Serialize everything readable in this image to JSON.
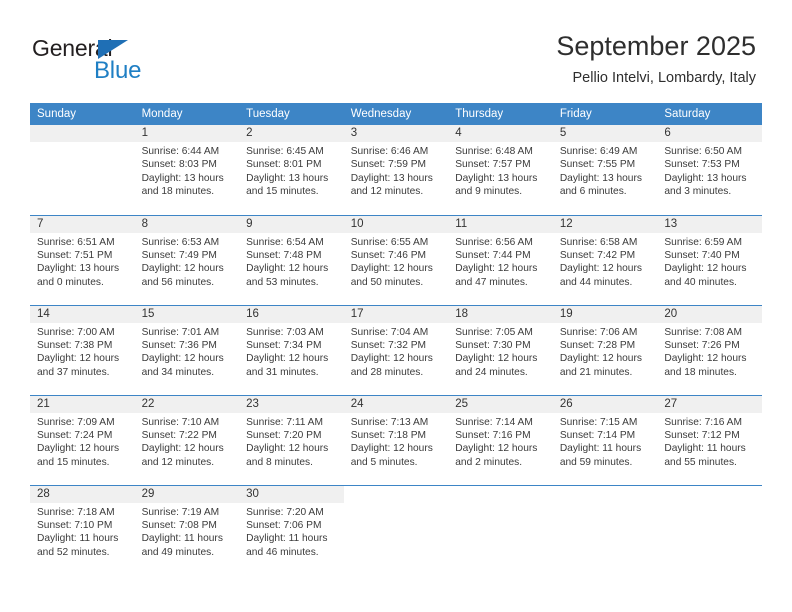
{
  "logo": {
    "word_one": "General",
    "word_two": "Blue",
    "triangle_color": "#1f6fb5",
    "blue_color": "#1f7fc4"
  },
  "header": {
    "title": "September 2025",
    "subtitle": "Pellio Intelvi, Lombardy, Italy",
    "header_bg": "#3d85c6",
    "daynum_bg": "#f0f0f0"
  },
  "calendar": {
    "weekday_headers": [
      "Sunday",
      "Monday",
      "Tuesday",
      "Wednesday",
      "Thursday",
      "Friday",
      "Saturday"
    ],
    "weeks": [
      [
        {
          "day": "",
          "blank": true
        },
        {
          "day": "1",
          "sunrise": "Sunrise: 6:44 AM",
          "sunset": "Sunset: 8:03 PM",
          "daylight_a": "Daylight: 13 hours",
          "daylight_b": "and 18 minutes."
        },
        {
          "day": "2",
          "sunrise": "Sunrise: 6:45 AM",
          "sunset": "Sunset: 8:01 PM",
          "daylight_a": "Daylight: 13 hours",
          "daylight_b": "and 15 minutes."
        },
        {
          "day": "3",
          "sunrise": "Sunrise: 6:46 AM",
          "sunset": "Sunset: 7:59 PM",
          "daylight_a": "Daylight: 13 hours",
          "daylight_b": "and 12 minutes."
        },
        {
          "day": "4",
          "sunrise": "Sunrise: 6:48 AM",
          "sunset": "Sunset: 7:57 PM",
          "daylight_a": "Daylight: 13 hours",
          "daylight_b": "and 9 minutes."
        },
        {
          "day": "5",
          "sunrise": "Sunrise: 6:49 AM",
          "sunset": "Sunset: 7:55 PM",
          "daylight_a": "Daylight: 13 hours",
          "daylight_b": "and 6 minutes."
        },
        {
          "day": "6",
          "sunrise": "Sunrise: 6:50 AM",
          "sunset": "Sunset: 7:53 PM",
          "daylight_a": "Daylight: 13 hours",
          "daylight_b": "and 3 minutes."
        }
      ],
      [
        {
          "day": "7",
          "sunrise": "Sunrise: 6:51 AM",
          "sunset": "Sunset: 7:51 PM",
          "daylight_a": "Daylight: 13 hours",
          "daylight_b": "and 0 minutes."
        },
        {
          "day": "8",
          "sunrise": "Sunrise: 6:53 AM",
          "sunset": "Sunset: 7:49 PM",
          "daylight_a": "Daylight: 12 hours",
          "daylight_b": "and 56 minutes."
        },
        {
          "day": "9",
          "sunrise": "Sunrise: 6:54 AM",
          "sunset": "Sunset: 7:48 PM",
          "daylight_a": "Daylight: 12 hours",
          "daylight_b": "and 53 minutes."
        },
        {
          "day": "10",
          "sunrise": "Sunrise: 6:55 AM",
          "sunset": "Sunset: 7:46 PM",
          "daylight_a": "Daylight: 12 hours",
          "daylight_b": "and 50 minutes."
        },
        {
          "day": "11",
          "sunrise": "Sunrise: 6:56 AM",
          "sunset": "Sunset: 7:44 PM",
          "daylight_a": "Daylight: 12 hours",
          "daylight_b": "and 47 minutes."
        },
        {
          "day": "12",
          "sunrise": "Sunrise: 6:58 AM",
          "sunset": "Sunset: 7:42 PM",
          "daylight_a": "Daylight: 12 hours",
          "daylight_b": "and 44 minutes."
        },
        {
          "day": "13",
          "sunrise": "Sunrise: 6:59 AM",
          "sunset": "Sunset: 7:40 PM",
          "daylight_a": "Daylight: 12 hours",
          "daylight_b": "and 40 minutes."
        }
      ],
      [
        {
          "day": "14",
          "sunrise": "Sunrise: 7:00 AM",
          "sunset": "Sunset: 7:38 PM",
          "daylight_a": "Daylight: 12 hours",
          "daylight_b": "and 37 minutes."
        },
        {
          "day": "15",
          "sunrise": "Sunrise: 7:01 AM",
          "sunset": "Sunset: 7:36 PM",
          "daylight_a": "Daylight: 12 hours",
          "daylight_b": "and 34 minutes."
        },
        {
          "day": "16",
          "sunrise": "Sunrise: 7:03 AM",
          "sunset": "Sunset: 7:34 PM",
          "daylight_a": "Daylight: 12 hours",
          "daylight_b": "and 31 minutes."
        },
        {
          "day": "17",
          "sunrise": "Sunrise: 7:04 AM",
          "sunset": "Sunset: 7:32 PM",
          "daylight_a": "Daylight: 12 hours",
          "daylight_b": "and 28 minutes."
        },
        {
          "day": "18",
          "sunrise": "Sunrise: 7:05 AM",
          "sunset": "Sunset: 7:30 PM",
          "daylight_a": "Daylight: 12 hours",
          "daylight_b": "and 24 minutes."
        },
        {
          "day": "19",
          "sunrise": "Sunrise: 7:06 AM",
          "sunset": "Sunset: 7:28 PM",
          "daylight_a": "Daylight: 12 hours",
          "daylight_b": "and 21 minutes."
        },
        {
          "day": "20",
          "sunrise": "Sunrise: 7:08 AM",
          "sunset": "Sunset: 7:26 PM",
          "daylight_a": "Daylight: 12 hours",
          "daylight_b": "and 18 minutes."
        }
      ],
      [
        {
          "day": "21",
          "sunrise": "Sunrise: 7:09 AM",
          "sunset": "Sunset: 7:24 PM",
          "daylight_a": "Daylight: 12 hours",
          "daylight_b": "and 15 minutes."
        },
        {
          "day": "22",
          "sunrise": "Sunrise: 7:10 AM",
          "sunset": "Sunset: 7:22 PM",
          "daylight_a": "Daylight: 12 hours",
          "daylight_b": "and 12 minutes."
        },
        {
          "day": "23",
          "sunrise": "Sunrise: 7:11 AM",
          "sunset": "Sunset: 7:20 PM",
          "daylight_a": "Daylight: 12 hours",
          "daylight_b": "and 8 minutes."
        },
        {
          "day": "24",
          "sunrise": "Sunrise: 7:13 AM",
          "sunset": "Sunset: 7:18 PM",
          "daylight_a": "Daylight: 12 hours",
          "daylight_b": "and 5 minutes."
        },
        {
          "day": "25",
          "sunrise": "Sunrise: 7:14 AM",
          "sunset": "Sunset: 7:16 PM",
          "daylight_a": "Daylight: 12 hours",
          "daylight_b": "and 2 minutes."
        },
        {
          "day": "26",
          "sunrise": "Sunrise: 7:15 AM",
          "sunset": "Sunset: 7:14 PM",
          "daylight_a": "Daylight: 11 hours",
          "daylight_b": "and 59 minutes."
        },
        {
          "day": "27",
          "sunrise": "Sunrise: 7:16 AM",
          "sunset": "Sunset: 7:12 PM",
          "daylight_a": "Daylight: 11 hours",
          "daylight_b": "and 55 minutes."
        }
      ],
      [
        {
          "day": "28",
          "sunrise": "Sunrise: 7:18 AM",
          "sunset": "Sunset: 7:10 PM",
          "daylight_a": "Daylight: 11 hours",
          "daylight_b": "and 52 minutes."
        },
        {
          "day": "29",
          "sunrise": "Sunrise: 7:19 AM",
          "sunset": "Sunset: 7:08 PM",
          "daylight_a": "Daylight: 11 hours",
          "daylight_b": "and 49 minutes."
        },
        {
          "day": "30",
          "sunrise": "Sunrise: 7:20 AM",
          "sunset": "Sunset: 7:06 PM",
          "daylight_a": "Daylight: 11 hours",
          "daylight_b": "and 46 minutes."
        },
        {
          "day": "",
          "blank": true,
          "nofill": true
        },
        {
          "day": "",
          "blank": true,
          "nofill": true
        },
        {
          "day": "",
          "blank": true,
          "nofill": true
        },
        {
          "day": "",
          "blank": true,
          "nofill": true
        }
      ]
    ]
  }
}
